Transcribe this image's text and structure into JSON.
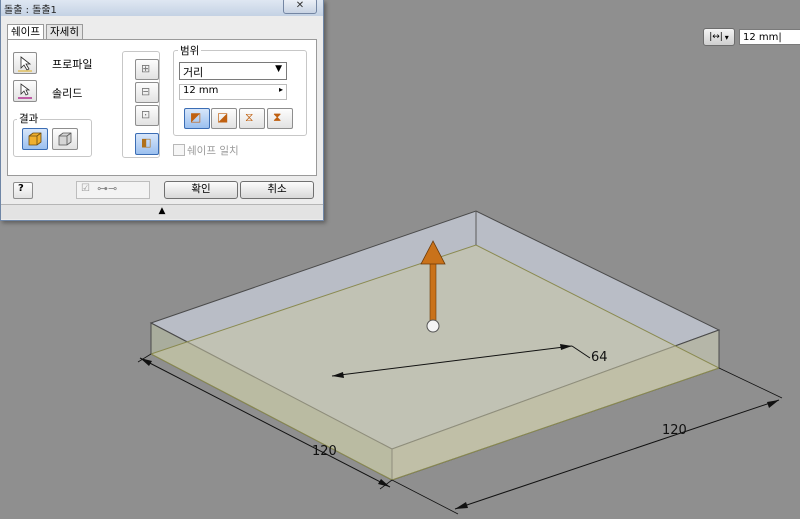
{
  "dialog": {
    "title": "돌출 : 돌출1",
    "close_glyph": "✕",
    "tabs": [
      "쉐이프",
      "자세히"
    ],
    "shape": {
      "profile_label": "프로파일",
      "solid_label": "솔리드",
      "result_label": "결과"
    },
    "extents": {
      "label": "범위",
      "type_value": "거리",
      "distance_value": "12 mm",
      "match_shape_label": "쉐이프 일치"
    },
    "ok_label": "확인",
    "cancel_label": "취소",
    "expand_glyph": "▲"
  },
  "minibar": {
    "value": "12 mm|"
  },
  "dimensions": {
    "front_width": "120",
    "right_depth": "120",
    "sketch_line": "64"
  },
  "colors": {
    "background": "#8f8f8f",
    "preview_box": "#b7bcc6",
    "base_face": "#c8c6a6",
    "direction_arrow": "#c9721a"
  }
}
